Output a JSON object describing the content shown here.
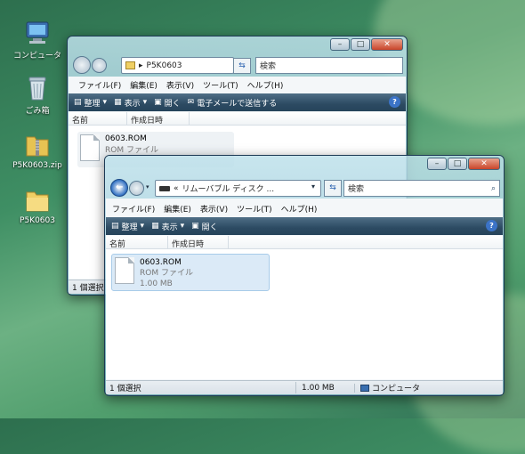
{
  "desktop": {
    "icons": [
      {
        "label": "コンピュータ",
        "icon": "computer-icon"
      },
      {
        "label": "ごみ箱",
        "icon": "recycle-bin-icon"
      },
      {
        "label": "P5K0603.zip",
        "icon": "zip-folder-icon"
      },
      {
        "label": "P5K0603",
        "icon": "folder-icon"
      }
    ]
  },
  "window_back": {
    "address": "P5K0603",
    "search_placeholder": "検索",
    "menu": [
      "ファイル(F)",
      "編集(E)",
      "表示(V)",
      "ツール(T)",
      "ヘルプ(H)"
    ],
    "toolbar": [
      "整理",
      "表示",
      "開く",
      "電子メールで送信する"
    ],
    "columns": [
      "名前",
      "作成日時"
    ],
    "file": {
      "name": "0603.ROM",
      "type": "ROM ファイル"
    },
    "status": "1 個選択"
  },
  "window_front": {
    "address": "リムーバブル ディスク ...",
    "address_prefix": "«",
    "search_placeholder": "検索",
    "menu": [
      "ファイル(F)",
      "編集(E)",
      "表示(V)",
      "ツール(T)",
      "ヘルプ(H)"
    ],
    "toolbar": [
      "整理",
      "表示",
      "開く"
    ],
    "columns": [
      "名前",
      "作成日時"
    ],
    "file": {
      "name": "0603.ROM",
      "type": "ROM ファイル",
      "size": "1.00 MB"
    },
    "status": {
      "selected": "1 個選択",
      "size": "1.00 MB",
      "location": "コンピュータ"
    }
  },
  "caption_buttons": {
    "minimize": "–",
    "maximize": "□",
    "close": "✕"
  },
  "colors": {
    "toolbar": "#2c4a62",
    "selection": "#dbeaf7",
    "desktop": "#3f8f64"
  }
}
